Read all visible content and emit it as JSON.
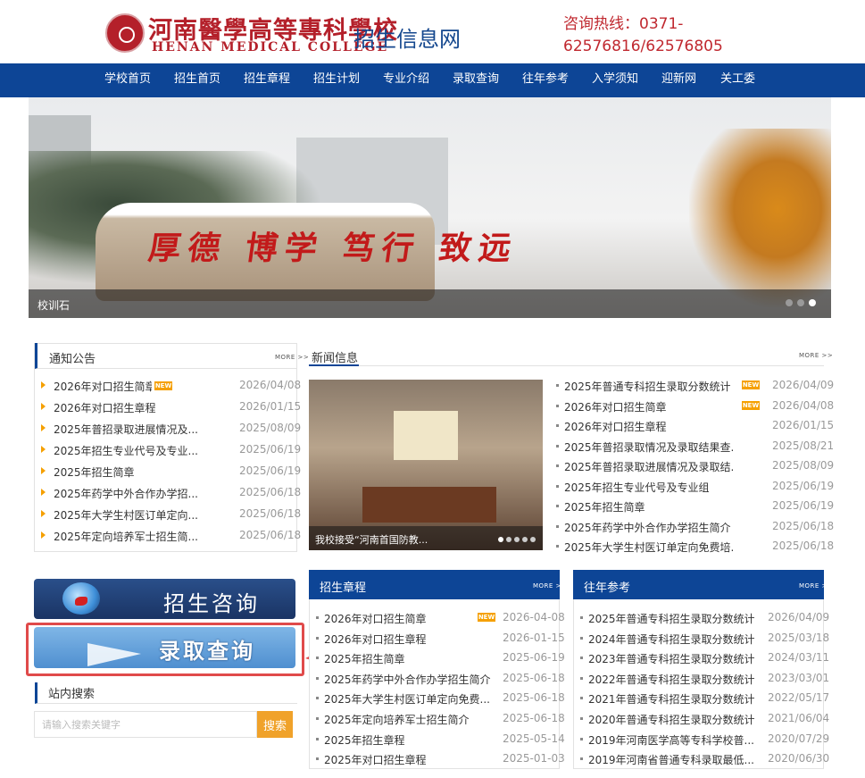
{
  "header": {
    "school_name_cn": "河南醫學高等專科學校",
    "school_name_en": "HENAN MEDICAL COLLEGE",
    "site_name": "招生信息网",
    "hotline": "咨询热线：0371-62576816/62576805"
  },
  "nav": {
    "items": [
      "学校首页",
      "招生首页",
      "招生章程",
      "招生计划",
      "专业介绍",
      "录取查询",
      "往年参考",
      "入学须知",
      "迎新网",
      "关工委"
    ]
  },
  "banner": {
    "caption": "校训石",
    "stone_text": "厚德 博学 笃行 致远",
    "slide_count": 3,
    "active_slide": 3
  },
  "notice": {
    "title": "通知公告",
    "more": "MORE >>",
    "items": [
      {
        "title": "2026年对口招生简章",
        "date": "2026/04/08",
        "new": true
      },
      {
        "title": "2026年对口招生章程",
        "date": "2026/01/15",
        "new": false
      },
      {
        "title": "2025年普招录取进展情况及...",
        "date": "2025/08/09",
        "new": false
      },
      {
        "title": "2025年招生专业代号及专业...",
        "date": "2025/06/19",
        "new": false
      },
      {
        "title": "2025年招生简章",
        "date": "2025/06/19",
        "new": false
      },
      {
        "title": "2025年药学中外合作办学招...",
        "date": "2025/06/18",
        "new": false
      },
      {
        "title": "2025年大学生村医订单定向...",
        "date": "2025/06/18",
        "new": false
      },
      {
        "title": "2025年定向培养军士招生简...",
        "date": "2025/06/18",
        "new": false
      }
    ]
  },
  "news": {
    "title": "新闻信息",
    "more": "MORE >>",
    "photo_caption": "我校接受“河南首国防教...",
    "photo_dots": 5,
    "items": [
      {
        "title": "2025年普通专科招生录取分数统计",
        "date": "2026/04/09",
        "new": true
      },
      {
        "title": "2026年对口招生简章",
        "date": "2026/04/08",
        "new": true
      },
      {
        "title": "2026年对口招生章程",
        "date": "2026/01/15",
        "new": false
      },
      {
        "title": "2025年普招录取情况及录取结果查...",
        "date": "2025/08/21",
        "new": false
      },
      {
        "title": "2025年普招录取进展情况及录取结...",
        "date": "2025/08/09",
        "new": false
      },
      {
        "title": "2025年招生专业代号及专业组",
        "date": "2025/06/19",
        "new": false
      },
      {
        "title": "2025年招生简章",
        "date": "2025/06/19",
        "new": false
      },
      {
        "title": "2025年药学中外合作办学招生简介",
        "date": "2025/06/18",
        "new": false
      },
      {
        "title": "2025年大学生村医订单定向免费培...",
        "date": "2025/06/18",
        "new": false
      }
    ]
  },
  "quick_links": {
    "consult": "招生咨询",
    "query": "录取查询"
  },
  "search": {
    "title": "站内搜索",
    "placeholder": "请输入搜索关键字",
    "button": "搜索"
  },
  "charter": {
    "title": "招生章程",
    "more": "MORE >>",
    "items": [
      {
        "title": "2026年对口招生简章",
        "date": "2026-04-08",
        "new": true
      },
      {
        "title": "2026年对口招生章程",
        "date": "2026-01-15",
        "new": false
      },
      {
        "title": "2025年招生简章",
        "date": "2025-06-19",
        "new": false
      },
      {
        "title": "2025年药学中外合作办学招生简介",
        "date": "2025-06-18",
        "new": false
      },
      {
        "title": "2025年大学生村医订单定向免费...",
        "date": "2025-06-18",
        "new": false
      },
      {
        "title": "2025年定向培养军士招生简介",
        "date": "2025-06-18",
        "new": false
      },
      {
        "title": "2025年招生章程",
        "date": "2025-05-14",
        "new": false
      },
      {
        "title": "2025年对口招生章程",
        "date": "2025-01-03",
        "new": false
      }
    ]
  },
  "reference": {
    "title": "往年参考",
    "more": "MORE >>",
    "items": [
      {
        "title": "2025年普通专科招生录取分数统计",
        "date": "2026/04/09"
      },
      {
        "title": "2024年普通专科招生录取分数统计",
        "date": "2025/03/18"
      },
      {
        "title": "2023年普通专科招生录取分数统计",
        "date": "2024/03/11"
      },
      {
        "title": "2022年普通专科招生录取分数统计",
        "date": "2023/03/01"
      },
      {
        "title": "2021年普通专科招生录取分数统计",
        "date": "2022/05/17"
      },
      {
        "title": "2020年普通专科招生录取分数统计",
        "date": "2021/06/04"
      },
      {
        "title": "2019年河南医学高等专科学校普...",
        "date": "2020/07/29"
      },
      {
        "title": "2019年河南省普通专科录取最低...",
        "date": "2020/06/30"
      }
    ]
  },
  "colors": {
    "brand_blue": "#0d4596",
    "brand_red": "#b4202a",
    "accent_orange": "#f5a000",
    "highlight_red": "#e04a4a"
  }
}
